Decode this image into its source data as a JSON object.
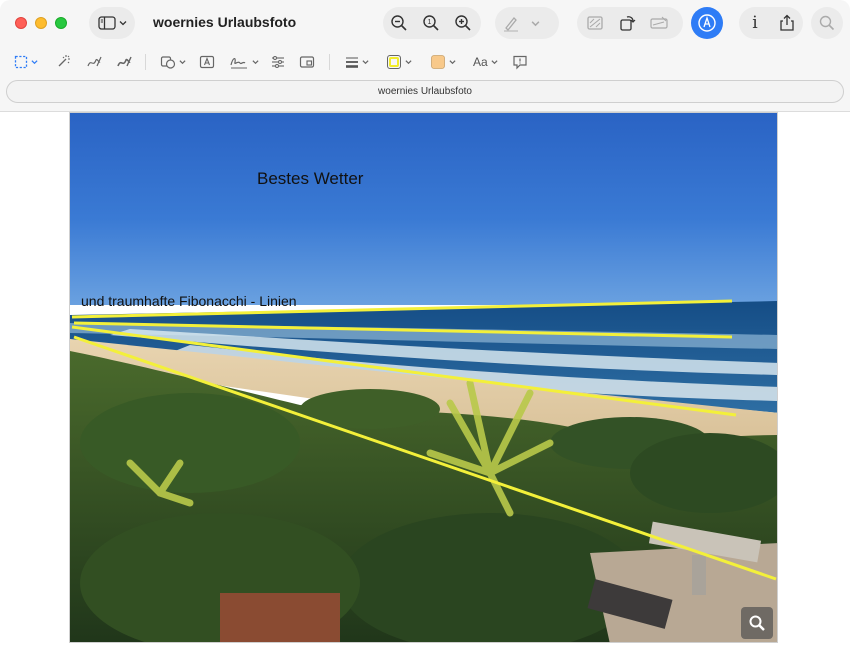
{
  "window": {
    "title": "woernies Urlaubsfoto"
  },
  "toolbar": {
    "sidebar_icon": "sidebar-icon",
    "zoom_out_icon": "zoom-out-icon",
    "actual_size_icon": "actual-size-icon",
    "zoom_in_icon": "zoom-in-icon",
    "highlight_icon": "highlighter-icon",
    "rotate_icon": "rotate-icon",
    "sign_icon": "signature-icon",
    "markup_icon": "markup-icon",
    "info_label": "i",
    "share_icon": "share-icon",
    "search_icon": "search-icon",
    "accent_color": "#2e7cf6"
  },
  "markup_toolbar": {
    "items": [
      "selection-icon",
      "instant-alpha-icon",
      "sketch-icon",
      "draw-icon",
      "shapes-icon",
      "text-icon",
      "sign-icon",
      "adjust-color-icon",
      "adjust-size-icon",
      "line-style-icon",
      "border-color-icon",
      "fill-color-icon",
      "text-style-icon",
      "notes-icon"
    ],
    "text_style_label": "Aa",
    "border_color": "#f2ec2a",
    "fill_color": "#f8c98a"
  },
  "filename_field": {
    "value": "woernies Urlaubsfoto"
  },
  "photo": {
    "annotation_1": "Bestes Wetter",
    "annotation_2": "und traumhafte Fibonacchi - Linien",
    "line_color": "#f3f03a"
  }
}
